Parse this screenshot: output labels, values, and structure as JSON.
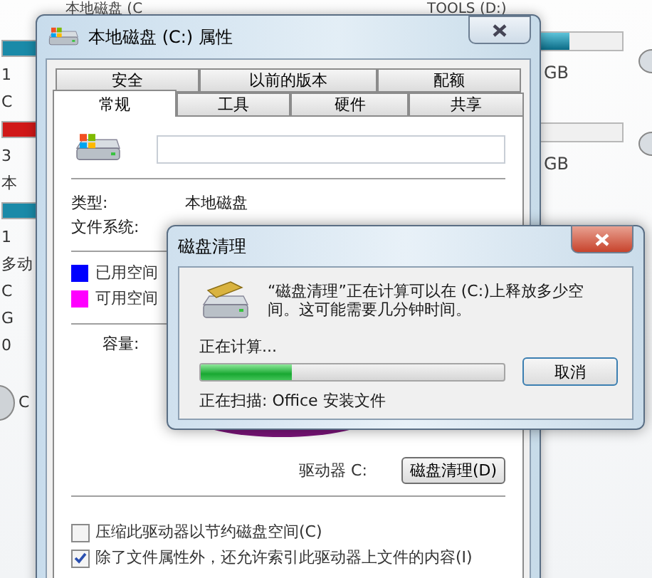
{
  "explorer": {
    "top_label": "本地磁盘 (C",
    "right_label": "TOOLS (D:)",
    "left_column": [
      {
        "kind": "bar",
        "color": "#1a8aa8"
      },
      {
        "kind": "text",
        "text": "1"
      },
      {
        "kind": "text",
        "text": "C"
      },
      {
        "kind": "bar",
        "color": "#d01818"
      },
      {
        "kind": "text",
        "text": "3"
      },
      {
        "kind": "text",
        "text": "本"
      },
      {
        "kind": "bar",
        "color": "#1a8aa8"
      },
      {
        "kind": "text",
        "text": "1"
      },
      {
        "kind": "text",
        "text": "多动"
      },
      {
        "kind": "text",
        "text": "C"
      },
      {
        "kind": "text",
        "text": "G"
      },
      {
        "kind": "text",
        "text": "0"
      },
      {
        "kind": "disc",
        "text": "C"
      }
    ],
    "right_drives": [
      {
        "level": 0.8,
        "size": "GB"
      },
      {
        "size": "GB"
      }
    ]
  },
  "properties": {
    "title": "本地磁盘 (C:) 属性",
    "tabs_back": [
      {
        "label": "安全",
        "selected": false
      },
      {
        "label": "以前的版本",
        "selected": false
      },
      {
        "label": "配额",
        "selected": false
      }
    ],
    "tabs_front": [
      {
        "label": "常规",
        "selected": true
      },
      {
        "label": "工具",
        "selected": false
      },
      {
        "label": "硬件",
        "selected": false
      },
      {
        "label": "共享",
        "selected": false
      }
    ],
    "fields": [
      {
        "label": "类型:",
        "value": "本地磁盘"
      },
      {
        "label": "文件系统:"
      }
    ],
    "legend": [
      {
        "label": "已用空间",
        "color": "#0000ff"
      },
      {
        "label": "可用空间",
        "color": "#ff00ff"
      }
    ],
    "capacity_label": "容量:",
    "drive_label": "驱动器 C:",
    "cleanup_button": "磁盘清理(D)",
    "options": [
      {
        "label": "压缩此驱动器以节约磁盘空间(C)",
        "checked": false
      },
      {
        "label": "除了文件属性外，还允许索引此驱动器上文件的内容(I)",
        "checked": true
      }
    ]
  },
  "cleanup": {
    "title": "磁盘清理",
    "message": "“磁盘清理”正在计算可以在 (C:)上释放多少空间。这可能需要几分钟时间。",
    "status": "正在计算...",
    "progress": {
      "level": 0.3
    },
    "cancel_button": "取消",
    "scanning": "正在扫描: Office 安装文件"
  }
}
